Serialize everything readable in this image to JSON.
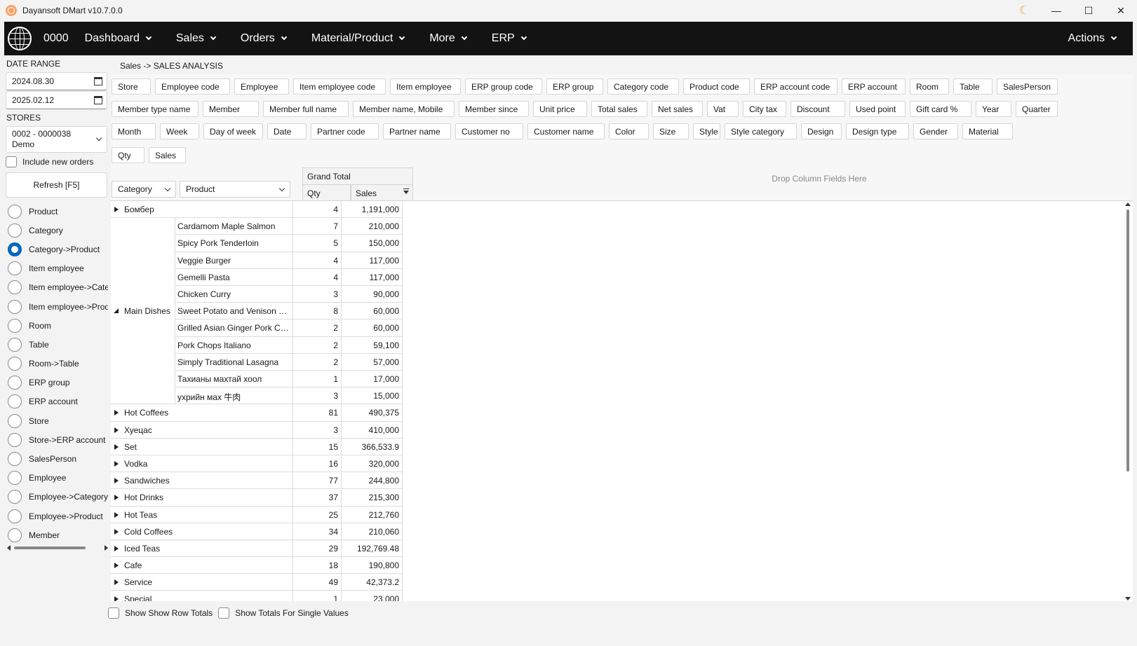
{
  "window": {
    "title": "Dayansoft DMart v10.7.0.0",
    "controls": [
      "moon-icon",
      "minimize-icon",
      "maximize-icon",
      "close-icon"
    ]
  },
  "menubar": {
    "store_code": "0000",
    "items": [
      "Dashboard",
      "Sales",
      "Orders",
      "Material/Product",
      "More",
      "ERP"
    ],
    "actions_label": "Actions"
  },
  "sidebar": {
    "date_range_label": "DATE RANGE",
    "date_from": "2024.08.30",
    "date_to": "2025.02.12",
    "stores_label": "STORES",
    "store_line1": "0002 - 0000038",
    "store_line2": "Demo",
    "include_new_orders_label": "Include new orders",
    "include_new_orders_checked": false,
    "refresh_label": "Refresh [F5]",
    "group_options": [
      "Product",
      "Category",
      "Category->Product",
      "Item employee",
      "Item employee->Category",
      "Item employee->Product",
      "Room",
      "Table",
      "Room->Table",
      "ERP group",
      "ERP account",
      "Store",
      "Store->ERP account",
      "SalesPerson",
      "Employee",
      "Employee->Category",
      "Employee->Product",
      "Member"
    ],
    "selected_option": "Category->Product"
  },
  "breadcrumb": "Sales -> SALES ANALYSIS",
  "fields": [
    [
      "Store",
      "Employee code",
      "Employee",
      "Item employee code",
      "Item employee",
      "ERP group code",
      "ERP group",
      "Category code",
      "Product code",
      "ERP account code",
      "ERP account",
      "Room",
      "Table",
      "SalesPerson"
    ],
    [
      "Member type name",
      "Member",
      "Member full name",
      "Member name, Mobile",
      "Member since",
      "Unit price",
      "Total sales",
      "Net sales",
      "Vat",
      "City tax",
      "Discount",
      "Used point",
      "Gift card %",
      "Year",
      "Quarter"
    ],
    [
      "Month",
      "Week",
      "Day of week",
      "Date",
      "Partner code",
      "Partner name",
      "Customer no",
      "Customer name",
      "Color",
      "Size",
      "Style",
      "Style category",
      "Design",
      "Design type",
      "Gender",
      "Material"
    ],
    [
      "Qty",
      "Sales"
    ]
  ],
  "drop_hint": "Drop Column Fields Here",
  "row_headers": [
    "Category",
    "Product"
  ],
  "grand_total_label": "Grand Total",
  "data_headers": [
    "Qty",
    "Sales"
  ],
  "grid": {
    "rows": [
      {
        "category": "Бомбер",
        "qty": "4",
        "sales": "1,191,000"
      },
      {
        "category": "Main Dishes",
        "expanded": true,
        "products": [
          {
            "product": "Cardamom Maple Salmon",
            "qty": "7",
            "sales": "210,000"
          },
          {
            "product": "Spicy Pork Tenderloin",
            "qty": "5",
            "sales": "150,000"
          },
          {
            "product": "Veggie Burger",
            "qty": "4",
            "sales": "117,000"
          },
          {
            "product": "Gemelli Pasta",
            "qty": "4",
            "sales": "117,000"
          },
          {
            "product": "Chicken Curry",
            "qty": "3",
            "sales": "90,000"
          },
          {
            "product": "Sweet Potato and Venison S...",
            "qty": "8",
            "sales": "60,000"
          },
          {
            "product": "Grilled Asian Ginger Pork Ch...",
            "qty": "2",
            "sales": "60,000"
          },
          {
            "product": "Pork Chops Italiano",
            "qty": "2",
            "sales": "59,100"
          },
          {
            "product": "Simply Traditional Lasagna",
            "qty": "2",
            "sales": "57,000"
          },
          {
            "product": "Тахианы махтай хоол",
            "qty": "1",
            "sales": "17,000"
          },
          {
            "product": "ухрийн мах 牛肉",
            "qty": "3",
            "sales": "15,000"
          }
        ]
      },
      {
        "category": "Hot Coffees",
        "qty": "81",
        "sales": "490,375"
      },
      {
        "category": "Хуецас",
        "qty": "3",
        "sales": "410,000"
      },
      {
        "category": "Set",
        "qty": "15",
        "sales": "366,533.9"
      },
      {
        "category": "Vodka",
        "qty": "16",
        "sales": "320,000"
      },
      {
        "category": "Sandwiches",
        "qty": "77",
        "sales": "244,800"
      },
      {
        "category": "Hot Drinks",
        "qty": "37",
        "sales": "215,300"
      },
      {
        "category": "Hot Teas",
        "qty": "25",
        "sales": "212,760"
      },
      {
        "category": "Cold Coffees",
        "qty": "34",
        "sales": "210,060"
      },
      {
        "category": "Iced Teas",
        "qty": "29",
        "sales": "192,769.48"
      },
      {
        "category": "Cafe",
        "qty": "18",
        "sales": "190,800"
      },
      {
        "category": "Service",
        "qty": "49",
        "sales": "42,373.2"
      },
      {
        "category": "Special",
        "qty": "1",
        "sales": "23,000"
      }
    ]
  },
  "footer": {
    "show_row_totals_label": "Show Show Row Totals",
    "show_totals_single_label": "Show Totals For Single Values"
  }
}
